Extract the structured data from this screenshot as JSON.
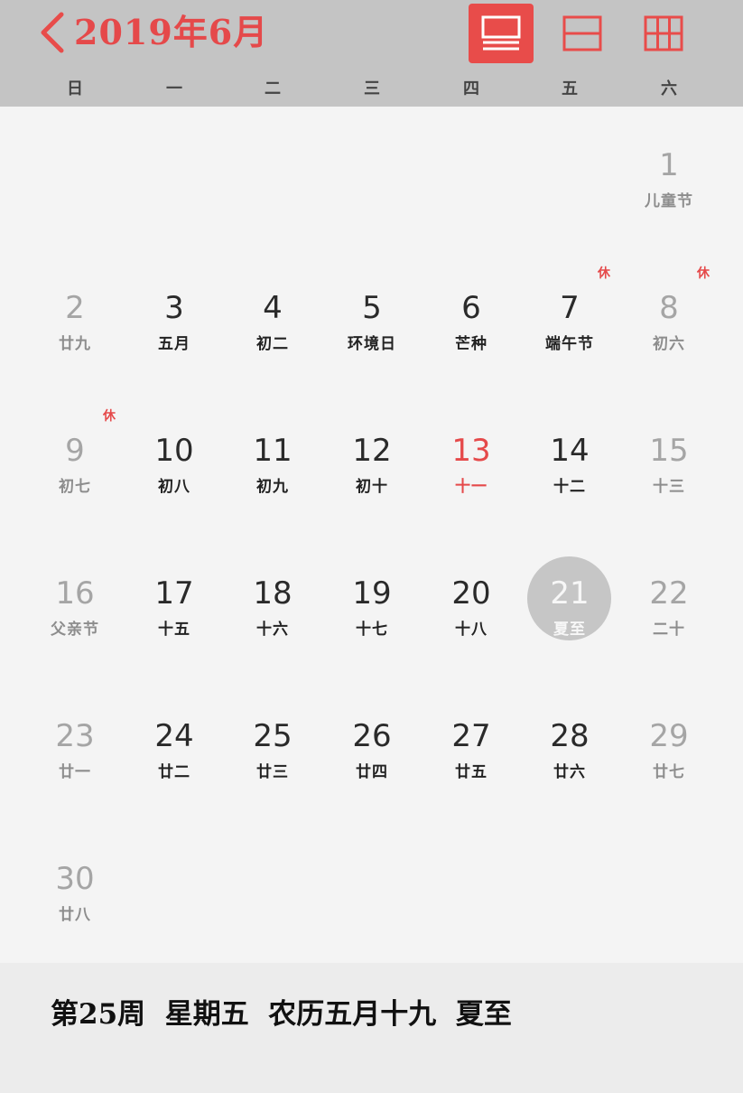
{
  "header": {
    "title": "2019年6月",
    "back_icon": "chevron-left-icon",
    "accent": "#e84c4a",
    "views": [
      {
        "name": "view-week-list",
        "icon": "list-view-icon",
        "active": true
      },
      {
        "name": "view-split",
        "icon": "split-view-icon",
        "active": false
      },
      {
        "name": "view-month-grid",
        "icon": "grid-view-icon",
        "active": false
      }
    ]
  },
  "weekdays": [
    "日",
    "一",
    "二",
    "三",
    "四",
    "五",
    "六"
  ],
  "days": [
    {
      "day": "1",
      "lunar": "儿童节",
      "weekend": true
    },
    {
      "day": "2",
      "lunar": "廿九",
      "weekend": true
    },
    {
      "day": "3",
      "lunar": "五月"
    },
    {
      "day": "4",
      "lunar": "初二"
    },
    {
      "day": "5",
      "lunar": "环境日"
    },
    {
      "day": "6",
      "lunar": "芒种"
    },
    {
      "day": "7",
      "lunar": "端午节",
      "badge": "休"
    },
    {
      "day": "8",
      "lunar": "初六",
      "weekend": true,
      "badge": "休"
    },
    {
      "day": "9",
      "lunar": "初七",
      "weekend": true,
      "badge": "休"
    },
    {
      "day": "10",
      "lunar": "初八"
    },
    {
      "day": "11",
      "lunar": "初九"
    },
    {
      "day": "12",
      "lunar": "初十"
    },
    {
      "day": "13",
      "lunar": "十一",
      "today": true
    },
    {
      "day": "14",
      "lunar": "十二"
    },
    {
      "day": "15",
      "lunar": "十三",
      "weekend": true
    },
    {
      "day": "16",
      "lunar": "父亲节",
      "weekend": true
    },
    {
      "day": "17",
      "lunar": "十五"
    },
    {
      "day": "18",
      "lunar": "十六"
    },
    {
      "day": "19",
      "lunar": "十七"
    },
    {
      "day": "20",
      "lunar": "十八"
    },
    {
      "day": "21",
      "lunar": "夏至",
      "selected": true
    },
    {
      "day": "22",
      "lunar": "二十",
      "weekend": true
    },
    {
      "day": "23",
      "lunar": "廿一",
      "weekend": true
    },
    {
      "day": "24",
      "lunar": "廿二"
    },
    {
      "day": "25",
      "lunar": "廿三"
    },
    {
      "day": "26",
      "lunar": "廿四"
    },
    {
      "day": "27",
      "lunar": "廿五"
    },
    {
      "day": "28",
      "lunar": "廿六"
    },
    {
      "day": "29",
      "lunar": "廿七",
      "weekend": true
    },
    {
      "day": "30",
      "lunar": "廿八",
      "weekend": true
    }
  ],
  "footer": {
    "status": "第25周  星期五  农历五月十九  夏至"
  }
}
